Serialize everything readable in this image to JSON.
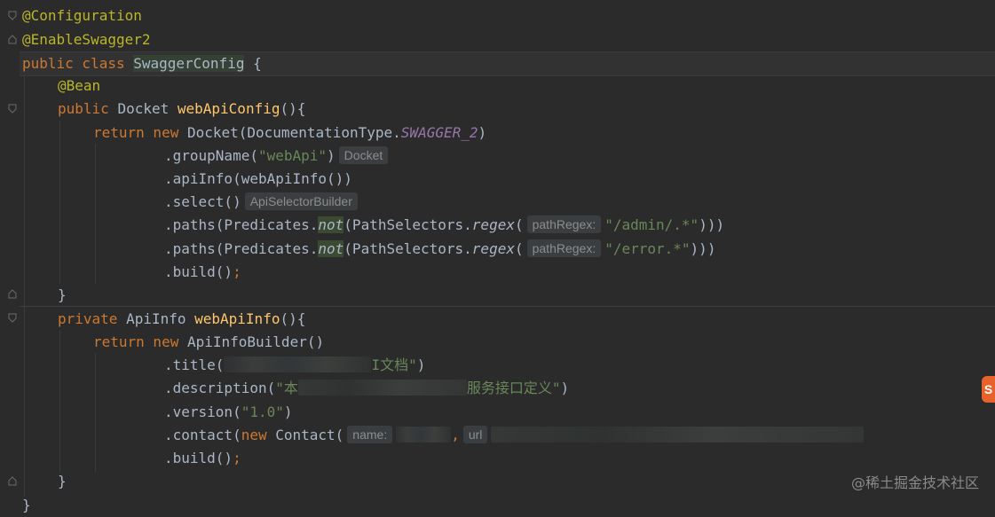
{
  "editor": {
    "lines": {
      "l1": "@Configuration",
      "l2": "@EnableSwagger2",
      "l3_kw": "public class ",
      "l3_cls": "SwaggerConfig",
      "l3_end": " {",
      "l4": "@Bean",
      "l5_kw": "public ",
      "l5_type": "Docket ",
      "l5_fn": "webApiConfig",
      "l5_end": "(){",
      "l6_kw": "return new ",
      "l6_a": "Docket(DocumentationType.",
      "l6_const": "SWAGGER_2",
      "l6_end": ")",
      "l7_a": ".groupName(",
      "l7_str": "\"webApi\"",
      "l7_end": ")",
      "l7_hint": "Docket",
      "l8": ".apiInfo(webApiInfo())",
      "l9": ".select()",
      "l9_hint": "ApiSelectorBuilder",
      "l10_a": ".paths(Predicates.",
      "l10_not": "not",
      "l10_b": "(PathSelectors.",
      "l10_regex": "regex",
      "l10_c": "(",
      "l10_hint": "pathRegex:",
      "l10_str": "\"/admin/.*\"",
      "l10_end": ")))",
      "l11_a": ".paths(Predicates.",
      "l11_not": "not",
      "l11_b": "(PathSelectors.",
      "l11_regex": "regex",
      "l11_c": "(",
      "l11_hint": "pathRegex:",
      "l11_str": "\"/error.*\"",
      "l11_end": ")))",
      "l12_a": ".build()",
      "l12_semi": ";",
      "l13": "}",
      "l14_kw": "private ",
      "l14_type": "ApiInfo ",
      "l14_fn": "webApiInfo",
      "l14_end": "(){",
      "l15_kw": "return new ",
      "l15_a": "ApiInfoBuilder()",
      "l16_a": ".title(",
      "l16_str": "I文档\"",
      "l16_end": ")",
      "l17_a": ".description(",
      "l17_str1": "\"本",
      "l17_str2": "服务接口定义\"",
      "l17_end": ")",
      "l18_a": ".version(",
      "l18_str": "\"1.0\"",
      "l18_end": ")",
      "l19_a": ".contact(",
      "l19_kw": "new ",
      "l19_b": "Contact(",
      "l19_hint1": "name:",
      "l19_comma": ",",
      "l19_hint2": "url",
      "l20_a": ".build()",
      "l20_semi": ";",
      "l21": "}",
      "l22": "}"
    }
  },
  "watermark": "@稀土掘金技术社区",
  "side_tag": "S",
  "colors": {
    "background": "#2b2b2b",
    "keyword": "#cc7832",
    "annotation": "#bbb529",
    "function": "#ffc66d",
    "string": "#6a8759",
    "constant": "#9876aa",
    "plain": "#a9b7c6"
  }
}
